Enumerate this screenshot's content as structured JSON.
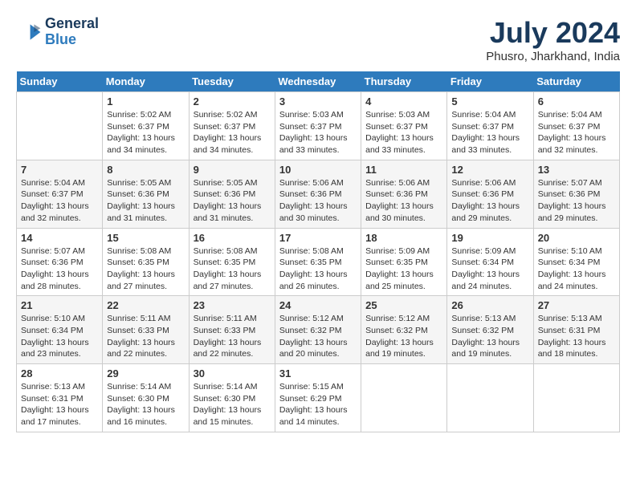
{
  "header": {
    "logo_line1": "General",
    "logo_line2": "Blue",
    "month_year": "July 2024",
    "location": "Phusro, Jharkhand, India"
  },
  "columns": [
    "Sunday",
    "Monday",
    "Tuesday",
    "Wednesday",
    "Thursday",
    "Friday",
    "Saturday"
  ],
  "weeks": [
    [
      {
        "day": "",
        "info": ""
      },
      {
        "day": "1",
        "info": "Sunrise: 5:02 AM\nSunset: 6:37 PM\nDaylight: 13 hours\nand 34 minutes."
      },
      {
        "day": "2",
        "info": "Sunrise: 5:02 AM\nSunset: 6:37 PM\nDaylight: 13 hours\nand 34 minutes."
      },
      {
        "day": "3",
        "info": "Sunrise: 5:03 AM\nSunset: 6:37 PM\nDaylight: 13 hours\nand 33 minutes."
      },
      {
        "day": "4",
        "info": "Sunrise: 5:03 AM\nSunset: 6:37 PM\nDaylight: 13 hours\nand 33 minutes."
      },
      {
        "day": "5",
        "info": "Sunrise: 5:04 AM\nSunset: 6:37 PM\nDaylight: 13 hours\nand 33 minutes."
      },
      {
        "day": "6",
        "info": "Sunrise: 5:04 AM\nSunset: 6:37 PM\nDaylight: 13 hours\nand 32 minutes."
      }
    ],
    [
      {
        "day": "7",
        "info": "Sunrise: 5:04 AM\nSunset: 6:37 PM\nDaylight: 13 hours\nand 32 minutes."
      },
      {
        "day": "8",
        "info": "Sunrise: 5:05 AM\nSunset: 6:36 PM\nDaylight: 13 hours\nand 31 minutes."
      },
      {
        "day": "9",
        "info": "Sunrise: 5:05 AM\nSunset: 6:36 PM\nDaylight: 13 hours\nand 31 minutes."
      },
      {
        "day": "10",
        "info": "Sunrise: 5:06 AM\nSunset: 6:36 PM\nDaylight: 13 hours\nand 30 minutes."
      },
      {
        "day": "11",
        "info": "Sunrise: 5:06 AM\nSunset: 6:36 PM\nDaylight: 13 hours\nand 30 minutes."
      },
      {
        "day": "12",
        "info": "Sunrise: 5:06 AM\nSunset: 6:36 PM\nDaylight: 13 hours\nand 29 minutes."
      },
      {
        "day": "13",
        "info": "Sunrise: 5:07 AM\nSunset: 6:36 PM\nDaylight: 13 hours\nand 29 minutes."
      }
    ],
    [
      {
        "day": "14",
        "info": "Sunrise: 5:07 AM\nSunset: 6:36 PM\nDaylight: 13 hours\nand 28 minutes."
      },
      {
        "day": "15",
        "info": "Sunrise: 5:08 AM\nSunset: 6:35 PM\nDaylight: 13 hours\nand 27 minutes."
      },
      {
        "day": "16",
        "info": "Sunrise: 5:08 AM\nSunset: 6:35 PM\nDaylight: 13 hours\nand 27 minutes."
      },
      {
        "day": "17",
        "info": "Sunrise: 5:08 AM\nSunset: 6:35 PM\nDaylight: 13 hours\nand 26 minutes."
      },
      {
        "day": "18",
        "info": "Sunrise: 5:09 AM\nSunset: 6:35 PM\nDaylight: 13 hours\nand 25 minutes."
      },
      {
        "day": "19",
        "info": "Sunrise: 5:09 AM\nSunset: 6:34 PM\nDaylight: 13 hours\nand 24 minutes."
      },
      {
        "day": "20",
        "info": "Sunrise: 5:10 AM\nSunset: 6:34 PM\nDaylight: 13 hours\nand 24 minutes."
      }
    ],
    [
      {
        "day": "21",
        "info": "Sunrise: 5:10 AM\nSunset: 6:34 PM\nDaylight: 13 hours\nand 23 minutes."
      },
      {
        "day": "22",
        "info": "Sunrise: 5:11 AM\nSunset: 6:33 PM\nDaylight: 13 hours\nand 22 minutes."
      },
      {
        "day": "23",
        "info": "Sunrise: 5:11 AM\nSunset: 6:33 PM\nDaylight: 13 hours\nand 22 minutes."
      },
      {
        "day": "24",
        "info": "Sunrise: 5:12 AM\nSunset: 6:32 PM\nDaylight: 13 hours\nand 20 minutes."
      },
      {
        "day": "25",
        "info": "Sunrise: 5:12 AM\nSunset: 6:32 PM\nDaylight: 13 hours\nand 19 minutes."
      },
      {
        "day": "26",
        "info": "Sunrise: 5:13 AM\nSunset: 6:32 PM\nDaylight: 13 hours\nand 19 minutes."
      },
      {
        "day": "27",
        "info": "Sunrise: 5:13 AM\nSunset: 6:31 PM\nDaylight: 13 hours\nand 18 minutes."
      }
    ],
    [
      {
        "day": "28",
        "info": "Sunrise: 5:13 AM\nSunset: 6:31 PM\nDaylight: 13 hours\nand 17 minutes."
      },
      {
        "day": "29",
        "info": "Sunrise: 5:14 AM\nSunset: 6:30 PM\nDaylight: 13 hours\nand 16 minutes."
      },
      {
        "day": "30",
        "info": "Sunrise: 5:14 AM\nSunset: 6:30 PM\nDaylight: 13 hours\nand 15 minutes."
      },
      {
        "day": "31",
        "info": "Sunrise: 5:15 AM\nSunset: 6:29 PM\nDaylight: 13 hours\nand 14 minutes."
      },
      {
        "day": "",
        "info": ""
      },
      {
        "day": "",
        "info": ""
      },
      {
        "day": "",
        "info": ""
      }
    ]
  ]
}
